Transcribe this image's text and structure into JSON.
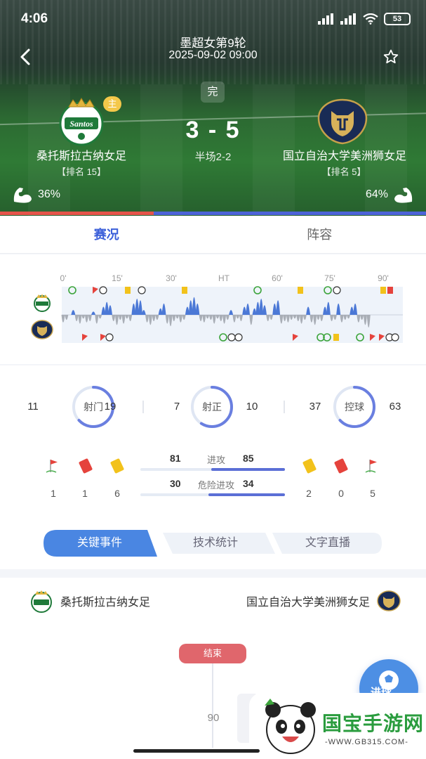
{
  "status_bar": {
    "time": "4:06",
    "battery": "53"
  },
  "header": {
    "league_round": "墨超女第9轮",
    "datetime": "2025-09-02 09:00",
    "match_state": "完",
    "host_badge": "主"
  },
  "match": {
    "home": {
      "name": "桑托斯拉古纳女足",
      "rank": "【排名 15】",
      "power": "36%"
    },
    "away": {
      "name": "国立自治大学美洲狮女足",
      "rank": "【排名 5】",
      "power": "64%"
    },
    "score": "3 - 5",
    "halftime": "半场2-2",
    "home_share": 0.36
  },
  "tabs": [
    {
      "label": "赛况",
      "active": true
    },
    {
      "label": "阵容",
      "active": false
    }
  ],
  "timeline": {
    "ticks": [
      "0'",
      "15'",
      "30'",
      "HT",
      "60'",
      "75'",
      "90'"
    ]
  },
  "stats": {
    "rings": [
      {
        "label": "射门",
        "home": "11",
        "away": "19",
        "away_share": 0.63
      },
      {
        "label": "射正",
        "home": "7",
        "away": "10",
        "away_share": 0.59
      },
      {
        "label": "控球",
        "home": "37",
        "away": "63",
        "away_share": 0.63
      }
    ],
    "cards_home": {
      "corners": "1",
      "red": "1",
      "yellow": "6"
    },
    "cards_away": {
      "yellow": "2",
      "red": "0",
      "corners": "5"
    },
    "bars": [
      {
        "label": "进攻",
        "home": "81",
        "away": "85",
        "away_share": 0.51
      },
      {
        "label": "危险进攻",
        "home": "30",
        "away": "34",
        "away_share": 0.53
      }
    ]
  },
  "sub_tabs": [
    {
      "label": "关键事件",
      "active": true
    },
    {
      "label": "技术统计",
      "active": false
    },
    {
      "label": "文字直播",
      "active": false
    }
  ],
  "events": {
    "home_name": "桑托斯拉古纳女足",
    "away_name": "国立自治大学美洲狮女足",
    "end_label": "结束",
    "minute": "90",
    "goal_button": "进球"
  },
  "watermark": {
    "text": "国宝手游网",
    "url": "-WWW.GB315.COM-"
  },
  "colors": {
    "accent": "#3b5fd9",
    "home_bar": "#e5544b",
    "away_bar": "#4d63d8",
    "yellow_card": "#f2c21b",
    "red_card": "#e5433c"
  }
}
